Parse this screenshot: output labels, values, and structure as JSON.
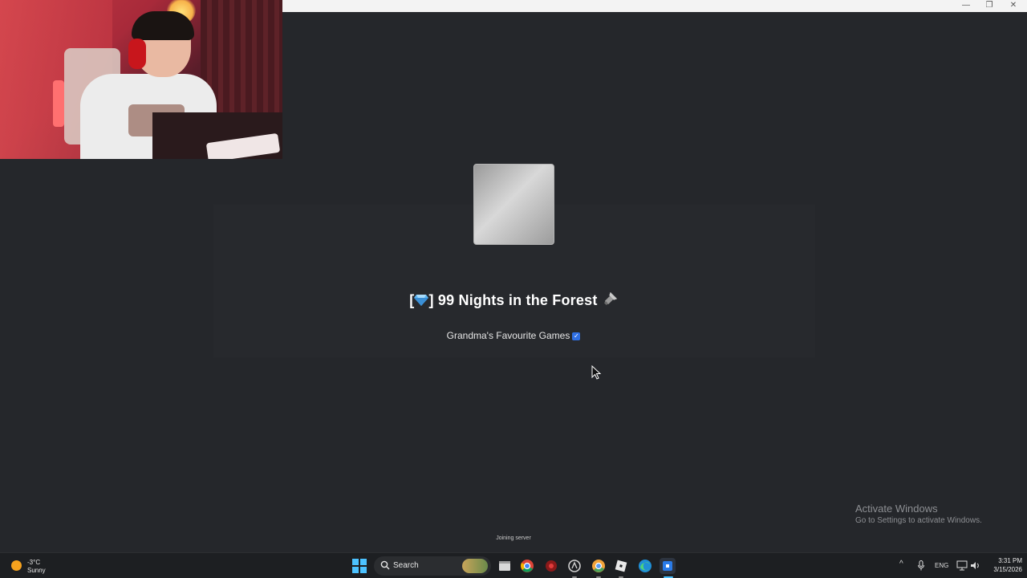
{
  "window": {
    "minimize_glyph": "—",
    "maximize_glyph": "❐",
    "close_glyph": "✕"
  },
  "loading": {
    "title_prefix": "[",
    "title_suffix": "] 99 Nights in the Forest",
    "creator": "Grandma's Favourite Games",
    "verified_glyph": "✓",
    "status": "Joining server"
  },
  "watermark": {
    "title": "Activate Windows",
    "subtitle": "Go to Settings to activate Windows."
  },
  "taskbar": {
    "weather_temp": "-3°C",
    "weather_condition": "Sunny",
    "search_label": "Search",
    "language": "ENG",
    "time": "3:31 PM",
    "date": "3/15/2026",
    "tray_chevron": "^",
    "apps": [
      "file-explorer",
      "chrome",
      "app-red",
      "app-gray",
      "chrome-canary",
      "roblox",
      "edge",
      "roblox-player"
    ]
  },
  "colors": {
    "background": "#25272b",
    "accent": "#2f6fe4",
    "start": "#4cc2ff"
  }
}
